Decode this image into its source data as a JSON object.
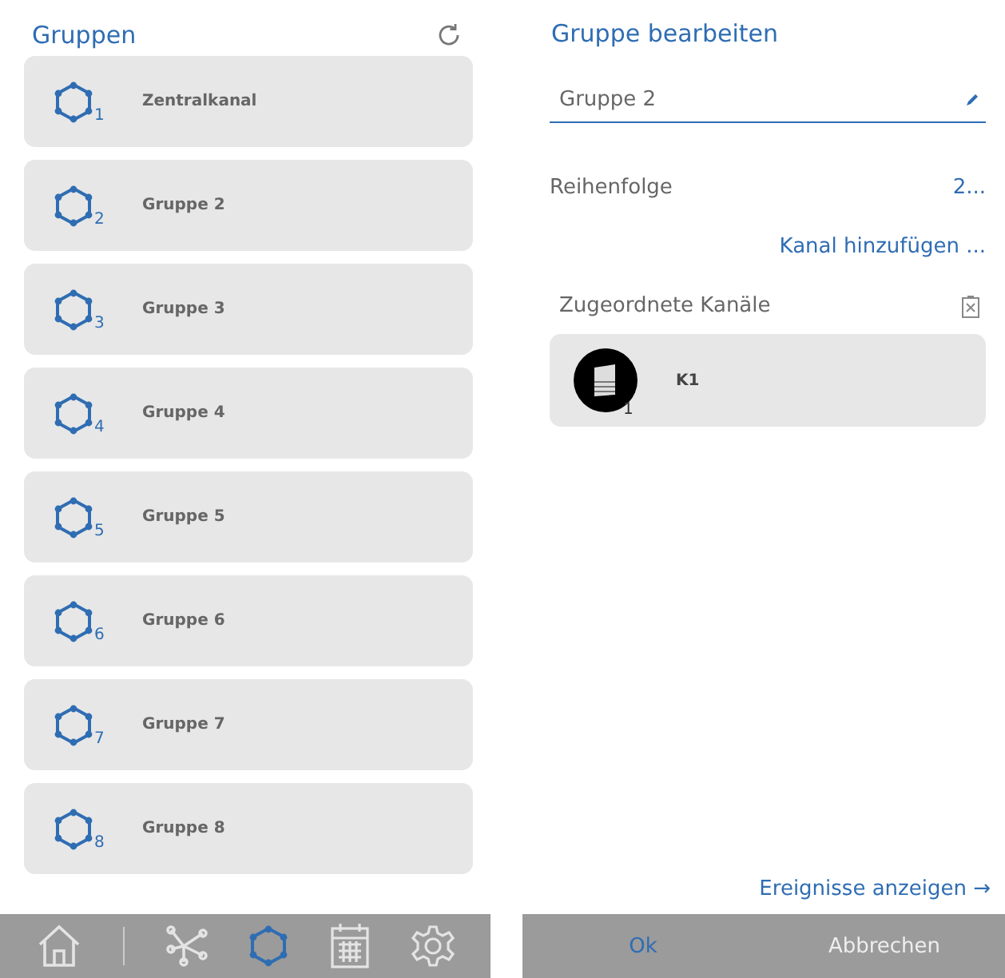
{
  "groups_panel": {
    "title": "Gruppen",
    "groups": [
      {
        "number": "1",
        "name": "Zentralkanal"
      },
      {
        "number": "2",
        "name": "Gruppe 2"
      },
      {
        "number": "3",
        "name": "Gruppe 3"
      },
      {
        "number": "4",
        "name": "Gruppe 4"
      },
      {
        "number": "5",
        "name": "Gruppe 5"
      },
      {
        "number": "6",
        "name": "Gruppe 6"
      },
      {
        "number": "7",
        "name": "Gruppe 7"
      },
      {
        "number": "8",
        "name": "Gruppe 8"
      }
    ]
  },
  "nav": [
    {
      "kind": "home",
      "selected": false
    },
    {
      "kind": "network",
      "selected": false
    },
    {
      "kind": "groups",
      "selected": true
    },
    {
      "kind": "calendar",
      "selected": false
    },
    {
      "kind": "settings",
      "selected": false
    }
  ],
  "edit_panel": {
    "title": "Gruppe bearbeiten",
    "name_value": "Gruppe 2",
    "order_label": "Reihenfolge",
    "order_value": "2...",
    "add_channel": "Kanal hinzufügen ...",
    "assigned_label": "Zugeordnete Kanäle",
    "channels": [
      {
        "number": "1",
        "name": "K1"
      }
    ],
    "events_link": "Ereignisse anzeigen →",
    "buttons": [
      {
        "label": "Ok",
        "kind": "primary"
      },
      {
        "label": "Abbrechen",
        "kind": "secondary"
      }
    ]
  }
}
